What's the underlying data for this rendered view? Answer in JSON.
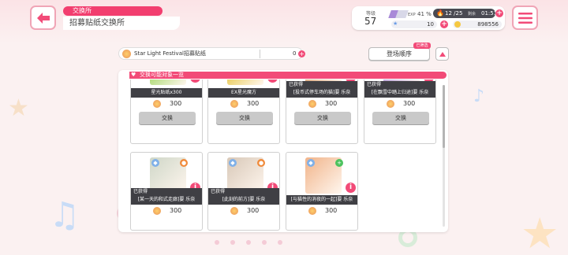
{
  "header": {
    "title_tag": "交换所",
    "subtitle": "招募贴纸交换所"
  },
  "status": {
    "level_label": "等级",
    "level": "57",
    "exp_label": "EXP",
    "exp_percent": "41 %",
    "exp_fill_fraction": 0.41,
    "stamina": "12 /25",
    "stamina_label": "剩余",
    "stamina_time": "01:51",
    "gems": "10",
    "coins": "898556"
  },
  "ticket": {
    "name": "Star Light Festival招募贴纸",
    "count": "0"
  },
  "sort": {
    "badge": "已筛选",
    "label": "登场顺序"
  },
  "panel": {
    "title": "交换可能对象一览"
  },
  "items": [
    {
      "name": "星光贴纸x300",
      "price": "300",
      "owned": "",
      "button": "交换",
      "thumb_color": "#a6d86a",
      "full": true
    },
    {
      "name": "EX星光魔方",
      "price": "300",
      "owned": "",
      "button": "交换",
      "thumb_color": "#e8c94e",
      "full": true
    },
    {
      "name": "[投币式停车场的猫]要 乐奈",
      "price": "300",
      "owned": "已获得",
      "button": "交换",
      "thumb_color": "#d9a070",
      "full": true
    },
    {
      "name": "[在飘雪中踏上归途]要 乐奈",
      "price": "300",
      "owned": "已获得",
      "button": "交换",
      "thumb_color": "#b29ad8",
      "full": true
    },
    {
      "name": "[某一天的和式走廊]要 乐奈",
      "price": "300",
      "owned": "已获得",
      "button": "",
      "thumb_color": "#cfd7c8",
      "full": false
    },
    {
      "name": "[此刻的前方]要 乐奈",
      "price": "300",
      "owned": "已获得",
      "button": "",
      "thumb_color": "#d8c8b8",
      "full": false
    },
    {
      "name": "[与猫性的消夜的一起]要 乐奈",
      "price": "300",
      "owned": "",
      "button": "",
      "thumb_color": "#f1b48a",
      "full": false
    }
  ],
  "colors": {
    "accent": "#f24b78",
    "background": "#fbf1f1"
  },
  "icons": {
    "back": "back-arrow-icon",
    "menu": "hamburger-menu-icon",
    "info": "info-icon",
    "sort": "chevron-up-icon"
  }
}
